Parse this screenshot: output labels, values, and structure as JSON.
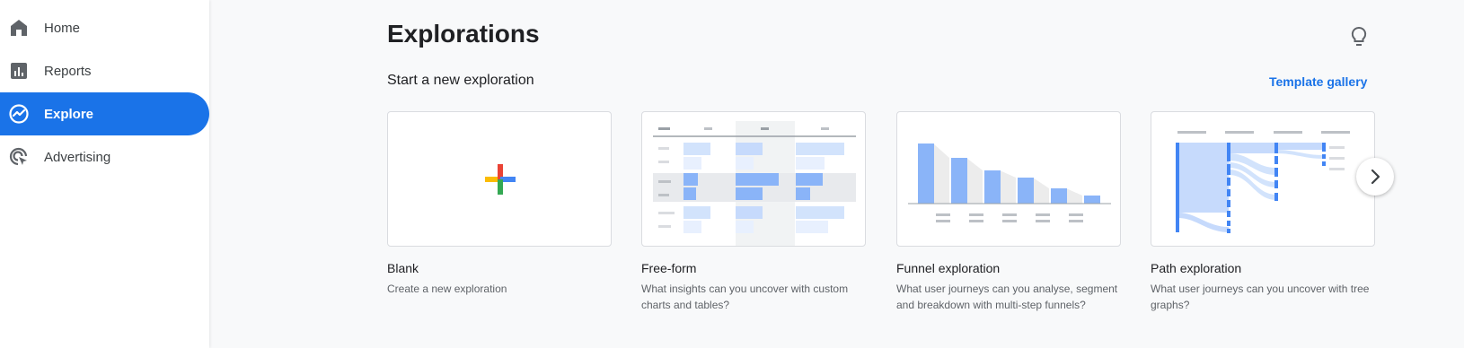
{
  "sidebar": {
    "items": [
      {
        "label": "Home",
        "icon": "home-icon"
      },
      {
        "label": "Reports",
        "icon": "reports-icon"
      },
      {
        "label": "Explore",
        "icon": "explore-icon",
        "active": true
      },
      {
        "label": "Advertising",
        "icon": "advertising-icon"
      }
    ]
  },
  "header": {
    "title": "Explorations"
  },
  "section": {
    "title": "Start a new exploration",
    "template_gallery_label": "Template gallery"
  },
  "cards": [
    {
      "title": "Blank",
      "description": "Create a new exploration"
    },
    {
      "title": "Free-form",
      "description": "What insights can you uncover with custom charts and tables?"
    },
    {
      "title": "Funnel exploration",
      "description": "What user journeys can you analyse, segment and breakdown with multi-step funnels?"
    },
    {
      "title": "Path exploration",
      "description": "What user journeys can you uncover with tree graphs?"
    }
  ],
  "colors": {
    "accent": "#1a73e8",
    "thumb_blue": "#8ab4f8",
    "thumb_light_blue": "#d2e3fc",
    "thumb_grey": "#e8eaed",
    "thumb_dark_blue": "#4285f4",
    "google_red": "#ea4335",
    "google_yellow": "#fbbc04",
    "google_green": "#34a853",
    "google_blue": "#4285f4"
  }
}
